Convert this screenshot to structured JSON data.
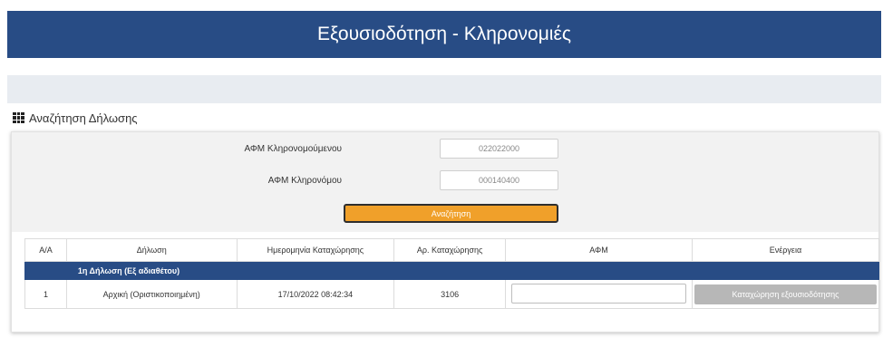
{
  "header": {
    "title": "Εξουσιοδότηση - Κληρονομιές"
  },
  "section": {
    "title": "Αναζήτηση Δήλωσης",
    "icon": "grid-icon"
  },
  "search": {
    "field1_label": "ΑΦΜ Κληρονομούμενου",
    "field1_value": "022022000",
    "field2_label": "ΑΦΜ Κληρονόμου",
    "field2_value": "000140400",
    "button_label": "Αναζήτηση"
  },
  "table": {
    "headers": [
      "Α/Α",
      "Δήλωση",
      "Ημερομηνία Καταχώρησης",
      "Αρ. Καταχώρησης",
      "ΑΦΜ",
      "Ενέργεια"
    ],
    "group_label": "1η Δήλωση (Εξ αδιαθέτου)",
    "rows": [
      {
        "aa": "1",
        "dilosi": "Αρχική (Οριστικοποιημένη)",
        "date": "17/10/2022 08:42:34",
        "ar": "3106",
        "afm": "",
        "action": "Καταχώρηση εξουσιοδότησης"
      }
    ]
  },
  "colors": {
    "header_bg": "#284c85",
    "button_orange": "#f0a02a",
    "button_disabled": "#b7b7b7"
  }
}
